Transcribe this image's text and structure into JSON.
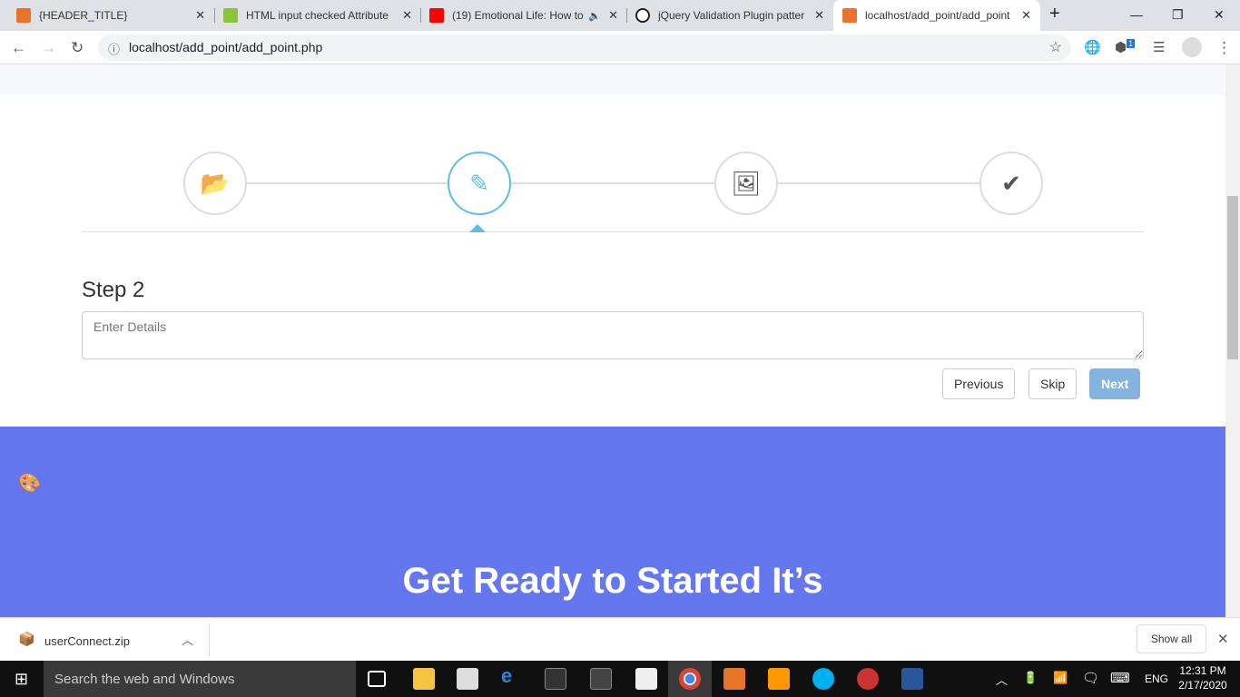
{
  "browser": {
    "tabs": [
      {
        "title": "{HEADER_TITLE}",
        "color": "#e8742a"
      },
      {
        "title": "HTML input checked Attribute",
        "color": "#8ac43f"
      },
      {
        "title": "(19) Emotional Life: How to",
        "color": "#ff0000"
      },
      {
        "title": "jQuery Validation Plugin patter",
        "color": "#222222"
      },
      {
        "title": "localhost/add_point/add_point",
        "color": "#e8742a",
        "active": true
      }
    ],
    "new_tab": "+",
    "url": "localhost/add_point/add_point.php",
    "extension_badge": "1"
  },
  "wizard": {
    "steps": [
      {
        "icon": "folder-open-icon",
        "glyph": "📂"
      },
      {
        "icon": "pencil-icon",
        "glyph": "✎",
        "active": true
      },
      {
        "icon": "image-icon",
        "glyph": "🖼"
      },
      {
        "icon": "check-icon",
        "glyph": "✔"
      }
    ],
    "title": "Step 2",
    "placeholder": "Enter Details",
    "previous": "Previous",
    "skip": "Skip",
    "next": "Next"
  },
  "hero": {
    "text": "Get Ready to Started It’s",
    "color": "#6577ef"
  },
  "downloads": {
    "file": "userConnect.zip",
    "show_all": "Show all"
  },
  "taskbar": {
    "search": "Search the web and Windows",
    "lang": "ENG",
    "time": "12:31 PM",
    "date": "2/17/2020"
  }
}
